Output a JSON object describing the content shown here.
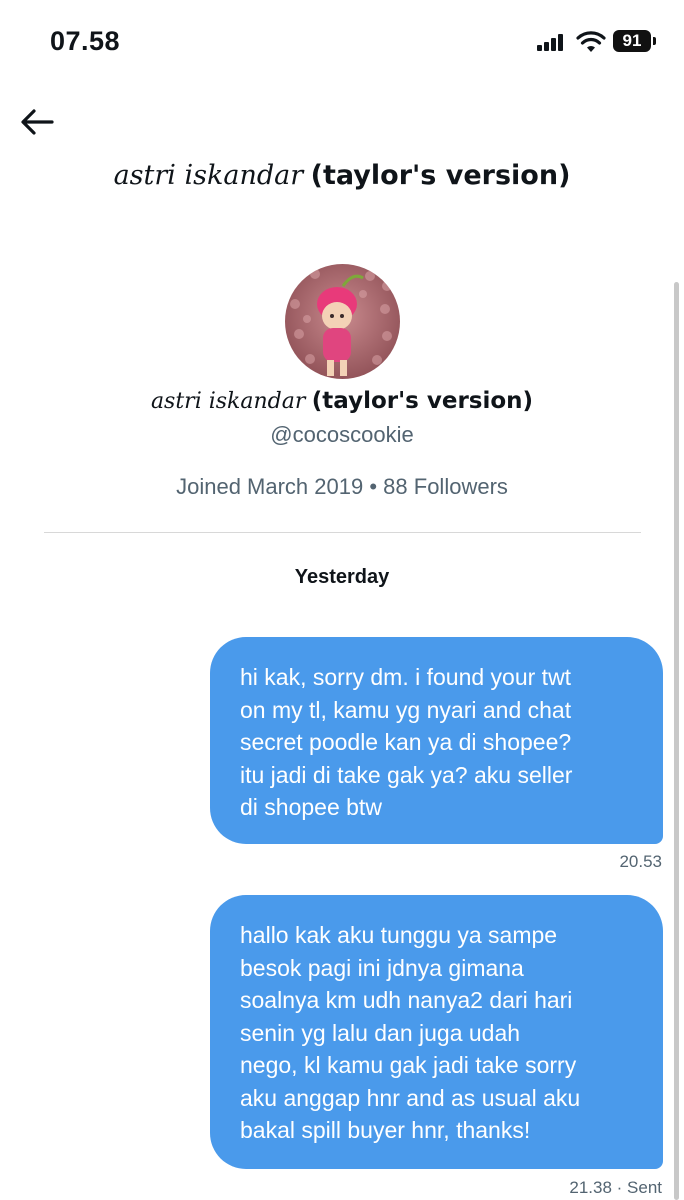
{
  "status_bar": {
    "time": "07.58",
    "battery": "91"
  },
  "header": {
    "name_italic": "astri iskandar",
    "name_bold": "(taylor's version)"
  },
  "profile": {
    "name_italic": "astri iskandar",
    "name_bold": "(taylor's version)",
    "handle": "@cocoscookie",
    "joined": "Joined March 2019",
    "separator": "•",
    "followers": "88 Followers"
  },
  "conversation": {
    "date_label": "Yesterday",
    "messages": [
      {
        "lines": [
          "hi kak, sorry dm. i found your twt",
          "on my tl, kamu yg nyari and chat",
          "secret poodle kan ya di shopee?",
          "itu jadi di take gak ya? aku seller",
          "di shopee btw"
        ],
        "time": "20.53"
      },
      {
        "lines": [
          "hallo kak aku tunggu ya sampe",
          "besok pagi ini jdnya gimana",
          "soalnya km udh nanya2 dari hari",
          "senin yg lalu dan juga udah",
          "nego, kl kamu gak jadi take sorry",
          "aku anggap hnr and as usual aku",
          "bakal spill buyer hnr, thanks!"
        ],
        "time": "21.38",
        "status": "· Sent"
      }
    ]
  },
  "icons": {
    "back": "arrow-left-icon",
    "signal": "cellular-signal-icon",
    "wifi": "wifi-icon",
    "battery": "battery-icon"
  },
  "colors": {
    "bubble": "#4a9aeb",
    "secondary_text": "#536471",
    "primary_text": "#0f1419"
  }
}
